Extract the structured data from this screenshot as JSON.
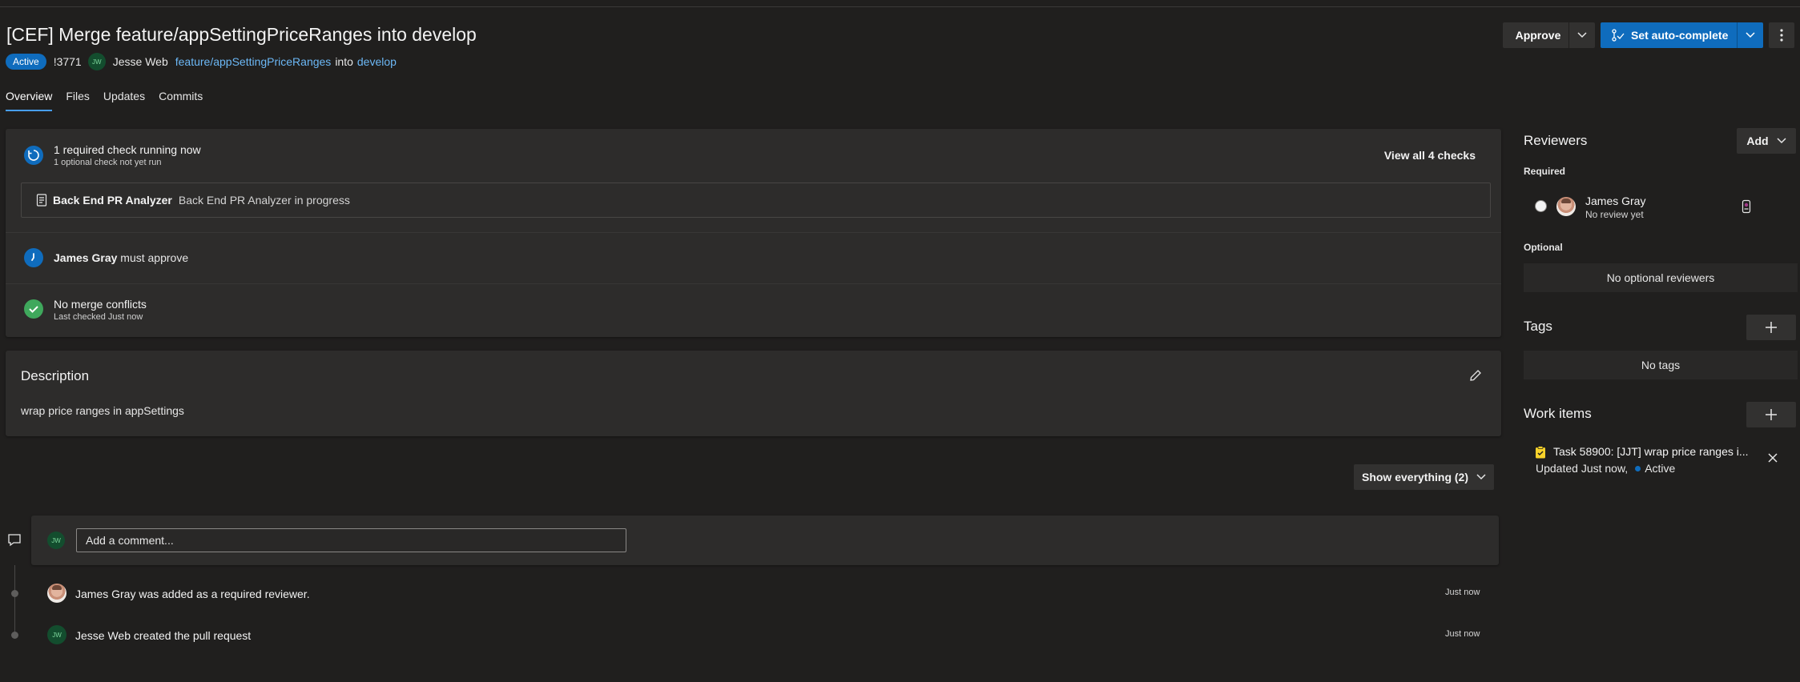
{
  "pr": {
    "title": "[CEF] Merge feature/appSettingPriceRanges into develop",
    "status": "Active",
    "id": "!3771",
    "author_initials": "JW",
    "author": "Jesse Web",
    "source_branch": "feature/appSettingPriceRanges",
    "into_text": "into",
    "target_branch": "develop"
  },
  "header_actions": {
    "approve_label": "Approve",
    "auto_complete_label": "Set auto-complete"
  },
  "tabs": [
    {
      "label": "Overview",
      "active": true
    },
    {
      "label": "Files"
    },
    {
      "label": "Updates"
    },
    {
      "label": "Commits"
    }
  ],
  "checks": {
    "title": "1 required check running now",
    "subtitle": "1 optional check not yet run",
    "view_all_label": "View all 4 checks",
    "analyzer_name": "Back End PR Analyzer",
    "analyzer_status": "Back End PR Analyzer in progress"
  },
  "approval": {
    "approver": "James Gray",
    "suffix": " must approve"
  },
  "merge": {
    "title": "No merge conflicts",
    "subtitle": "Last checked Just now"
  },
  "description": {
    "heading": "Description",
    "body": "wrap price ranges in appSettings"
  },
  "filter": {
    "label": "Show everything (2)"
  },
  "comment": {
    "placeholder": "Add a comment..."
  },
  "timeline": [
    {
      "text": "James Gray was added as a required reviewer.",
      "time": "Just now"
    },
    {
      "initials": "JW",
      "text": "Jesse Web created the pull request",
      "time": "Just now"
    }
  ],
  "sidebar": {
    "reviewers_heading": "Reviewers",
    "add_label": "Add",
    "required_label": "Required",
    "required_reviewer_name": "James Gray",
    "required_reviewer_status": "No review yet",
    "optional_label": "Optional",
    "no_optional_text": "No optional reviewers",
    "tags_heading": "Tags",
    "no_tags_text": "No tags",
    "work_items_heading": "Work items",
    "work_item_title": "Task 58900: [JJT] wrap price ranges i...",
    "work_item_updated": "Updated Just now,",
    "work_item_state": "Active"
  },
  "colors": {
    "background": "#201f1e",
    "card": "#2d2c2b",
    "accent": "#0f6cbd",
    "link": "#6cb8f6",
    "success": "#13a10e",
    "work_item": "#f8d22a"
  }
}
